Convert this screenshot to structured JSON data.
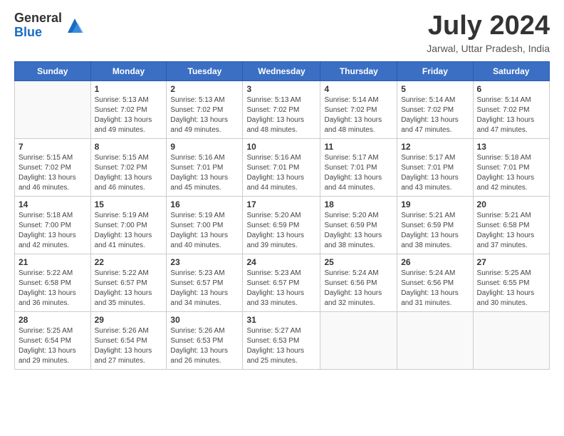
{
  "header": {
    "logo_general": "General",
    "logo_blue": "Blue",
    "main_title": "July 2024",
    "subtitle": "Jarwal, Uttar Pradesh, India"
  },
  "calendar": {
    "weekdays": [
      "Sunday",
      "Monday",
      "Tuesday",
      "Wednesday",
      "Thursday",
      "Friday",
      "Saturday"
    ],
    "weeks": [
      [
        {
          "day": "",
          "info": ""
        },
        {
          "day": "1",
          "info": "Sunrise: 5:13 AM\nSunset: 7:02 PM\nDaylight: 13 hours\nand 49 minutes."
        },
        {
          "day": "2",
          "info": "Sunrise: 5:13 AM\nSunset: 7:02 PM\nDaylight: 13 hours\nand 49 minutes."
        },
        {
          "day": "3",
          "info": "Sunrise: 5:13 AM\nSunset: 7:02 PM\nDaylight: 13 hours\nand 48 minutes."
        },
        {
          "day": "4",
          "info": "Sunrise: 5:14 AM\nSunset: 7:02 PM\nDaylight: 13 hours\nand 48 minutes."
        },
        {
          "day": "5",
          "info": "Sunrise: 5:14 AM\nSunset: 7:02 PM\nDaylight: 13 hours\nand 47 minutes."
        },
        {
          "day": "6",
          "info": "Sunrise: 5:14 AM\nSunset: 7:02 PM\nDaylight: 13 hours\nand 47 minutes."
        }
      ],
      [
        {
          "day": "7",
          "info": "Sunrise: 5:15 AM\nSunset: 7:02 PM\nDaylight: 13 hours\nand 46 minutes."
        },
        {
          "day": "8",
          "info": "Sunrise: 5:15 AM\nSunset: 7:02 PM\nDaylight: 13 hours\nand 46 minutes."
        },
        {
          "day": "9",
          "info": "Sunrise: 5:16 AM\nSunset: 7:01 PM\nDaylight: 13 hours\nand 45 minutes."
        },
        {
          "day": "10",
          "info": "Sunrise: 5:16 AM\nSunset: 7:01 PM\nDaylight: 13 hours\nand 44 minutes."
        },
        {
          "day": "11",
          "info": "Sunrise: 5:17 AM\nSunset: 7:01 PM\nDaylight: 13 hours\nand 44 minutes."
        },
        {
          "day": "12",
          "info": "Sunrise: 5:17 AM\nSunset: 7:01 PM\nDaylight: 13 hours\nand 43 minutes."
        },
        {
          "day": "13",
          "info": "Sunrise: 5:18 AM\nSunset: 7:01 PM\nDaylight: 13 hours\nand 42 minutes."
        }
      ],
      [
        {
          "day": "14",
          "info": "Sunrise: 5:18 AM\nSunset: 7:00 PM\nDaylight: 13 hours\nand 42 minutes."
        },
        {
          "day": "15",
          "info": "Sunrise: 5:19 AM\nSunset: 7:00 PM\nDaylight: 13 hours\nand 41 minutes."
        },
        {
          "day": "16",
          "info": "Sunrise: 5:19 AM\nSunset: 7:00 PM\nDaylight: 13 hours\nand 40 minutes."
        },
        {
          "day": "17",
          "info": "Sunrise: 5:20 AM\nSunset: 6:59 PM\nDaylight: 13 hours\nand 39 minutes."
        },
        {
          "day": "18",
          "info": "Sunrise: 5:20 AM\nSunset: 6:59 PM\nDaylight: 13 hours\nand 38 minutes."
        },
        {
          "day": "19",
          "info": "Sunrise: 5:21 AM\nSunset: 6:59 PM\nDaylight: 13 hours\nand 38 minutes."
        },
        {
          "day": "20",
          "info": "Sunrise: 5:21 AM\nSunset: 6:58 PM\nDaylight: 13 hours\nand 37 minutes."
        }
      ],
      [
        {
          "day": "21",
          "info": "Sunrise: 5:22 AM\nSunset: 6:58 PM\nDaylight: 13 hours\nand 36 minutes."
        },
        {
          "day": "22",
          "info": "Sunrise: 5:22 AM\nSunset: 6:57 PM\nDaylight: 13 hours\nand 35 minutes."
        },
        {
          "day": "23",
          "info": "Sunrise: 5:23 AM\nSunset: 6:57 PM\nDaylight: 13 hours\nand 34 minutes."
        },
        {
          "day": "24",
          "info": "Sunrise: 5:23 AM\nSunset: 6:57 PM\nDaylight: 13 hours\nand 33 minutes."
        },
        {
          "day": "25",
          "info": "Sunrise: 5:24 AM\nSunset: 6:56 PM\nDaylight: 13 hours\nand 32 minutes."
        },
        {
          "day": "26",
          "info": "Sunrise: 5:24 AM\nSunset: 6:56 PM\nDaylight: 13 hours\nand 31 minutes."
        },
        {
          "day": "27",
          "info": "Sunrise: 5:25 AM\nSunset: 6:55 PM\nDaylight: 13 hours\nand 30 minutes."
        }
      ],
      [
        {
          "day": "28",
          "info": "Sunrise: 5:25 AM\nSunset: 6:54 PM\nDaylight: 13 hours\nand 29 minutes."
        },
        {
          "day": "29",
          "info": "Sunrise: 5:26 AM\nSunset: 6:54 PM\nDaylight: 13 hours\nand 27 minutes."
        },
        {
          "day": "30",
          "info": "Sunrise: 5:26 AM\nSunset: 6:53 PM\nDaylight: 13 hours\nand 26 minutes."
        },
        {
          "day": "31",
          "info": "Sunrise: 5:27 AM\nSunset: 6:53 PM\nDaylight: 13 hours\nand 25 minutes."
        },
        {
          "day": "",
          "info": ""
        },
        {
          "day": "",
          "info": ""
        },
        {
          "day": "",
          "info": ""
        }
      ]
    ]
  }
}
